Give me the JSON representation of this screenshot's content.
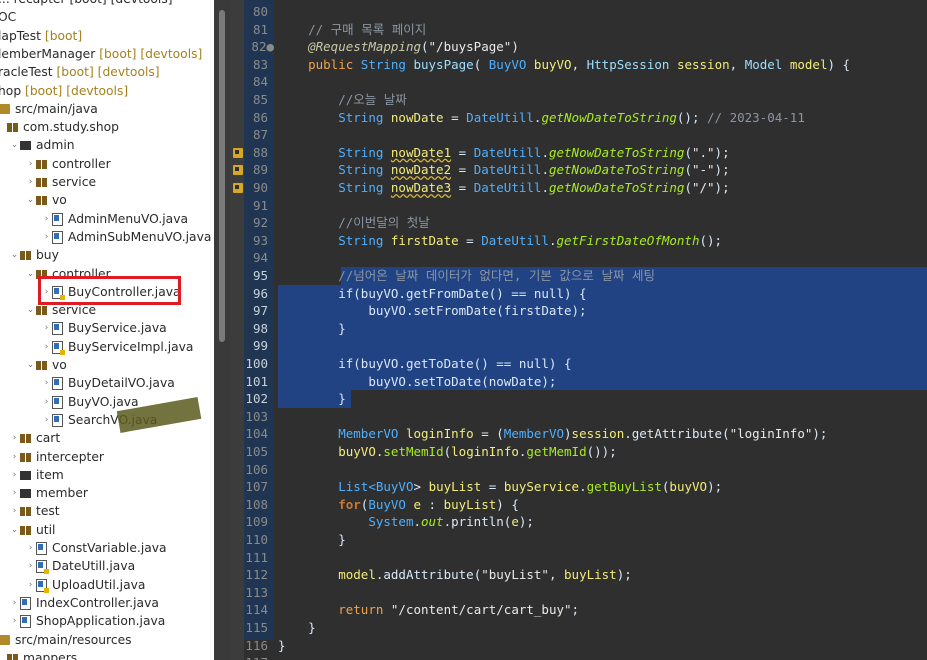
{
  "explorer": {
    "rows": [
      {
        "indent": 0,
        "tw": "",
        "icon": "blank",
        "text": "... recapter [boot] [devtools]"
      },
      {
        "indent": 0,
        "tw": "",
        "icon": "blank",
        "text": "OC"
      },
      {
        "indent": 0,
        "tw": "",
        "icon": "blank",
        "text": "lapTest",
        "suffix": " [boot]"
      },
      {
        "indent": 0,
        "tw": "",
        "icon": "blank",
        "text": "lemberManager",
        "suffix": " [boot] [devtools]"
      },
      {
        "indent": 0,
        "tw": "",
        "icon": "blank",
        "text": "racleTest",
        "suffix": " [boot] [devtools]"
      },
      {
        "indent": 0,
        "tw": "",
        "icon": "blank",
        "text": "hop",
        "suffix": " [boot] [devtools]"
      },
      {
        "indent": 0,
        "tw": "",
        "icon": "src",
        "text": "src/main/java"
      },
      {
        "indent": 1,
        "tw": "",
        "icon": "pkg",
        "text": "com.study.shop"
      },
      {
        "indent": 2,
        "tw": "⌄",
        "icon": "pkgd",
        "text": "admin"
      },
      {
        "indent": 3,
        "tw": "›",
        "icon": "pkg",
        "text": "controller"
      },
      {
        "indent": 3,
        "tw": "›",
        "icon": "pkg",
        "text": "service"
      },
      {
        "indent": 3,
        "tw": "⌄",
        "icon": "pkg",
        "text": "vo"
      },
      {
        "indent": 4,
        "tw": "›",
        "icon": "java",
        "text": "AdminMenuVO.java"
      },
      {
        "indent": 4,
        "tw": "›",
        "icon": "java",
        "text": "AdminSubMenuVO.java"
      },
      {
        "indent": 2,
        "tw": "⌄",
        "icon": "pkg",
        "text": "buy"
      },
      {
        "indent": 3,
        "tw": "⌄",
        "icon": "pkg",
        "text": "controller"
      },
      {
        "indent": 4,
        "tw": "›",
        "icon": "javaw",
        "text": "BuyController.java"
      },
      {
        "indent": 3,
        "tw": "⌄",
        "icon": "pkg",
        "text": "service"
      },
      {
        "indent": 4,
        "tw": "›",
        "icon": "java",
        "text": "BuyService.java"
      },
      {
        "indent": 4,
        "tw": "›",
        "icon": "javaw",
        "text": "BuyServiceImpl.java"
      },
      {
        "indent": 3,
        "tw": "⌄",
        "icon": "pkg",
        "text": "vo"
      },
      {
        "indent": 4,
        "tw": "›",
        "icon": "java",
        "text": "BuyDetailVO.java"
      },
      {
        "indent": 4,
        "tw": "›",
        "icon": "java",
        "text": "BuyVO.java"
      },
      {
        "indent": 4,
        "tw": "›",
        "icon": "java",
        "text": "SearchVO.java"
      },
      {
        "indent": 2,
        "tw": "›",
        "icon": "pkg",
        "text": "cart"
      },
      {
        "indent": 2,
        "tw": "›",
        "icon": "pkg",
        "text": "intercepter"
      },
      {
        "indent": 2,
        "tw": "›",
        "icon": "pkgd",
        "text": "item"
      },
      {
        "indent": 2,
        "tw": "›",
        "icon": "pkgd",
        "text": "member"
      },
      {
        "indent": 2,
        "tw": "›",
        "icon": "pkg",
        "text": "test"
      },
      {
        "indent": 2,
        "tw": "⌄",
        "icon": "pkg",
        "text": "util"
      },
      {
        "indent": 3,
        "tw": "›",
        "icon": "java",
        "text": "ConstVariable.java"
      },
      {
        "indent": 3,
        "tw": "›",
        "icon": "javaw",
        "text": "DateUtill.java"
      },
      {
        "indent": 3,
        "tw": "›",
        "icon": "javaw",
        "text": "UploadUtil.java"
      },
      {
        "indent": 2,
        "tw": "›",
        "icon": "java",
        "text": "IndexController.java"
      },
      {
        "indent": 2,
        "tw": "›",
        "icon": "java",
        "text": "ShopApplication.java"
      },
      {
        "indent": 0,
        "tw": "",
        "icon": "src",
        "text": "src/main/resources"
      },
      {
        "indent": 1,
        "tw": "",
        "icon": "pkg",
        "text": "mappers"
      }
    ]
  },
  "editor": {
    "lines": [
      {
        "n": "80",
        "t": []
      },
      {
        "n": "81",
        "t": [
          [
            "    ",
            "txt"
          ],
          [
            "// 구매 목록 페이지",
            "com"
          ]
        ]
      },
      {
        "n": "82●",
        "t": [
          [
            "    ",
            "txt"
          ],
          [
            "@RequestMapping",
            "ann"
          ],
          [
            "(",
            "txt"
          ],
          [
            "\"/buysPage\"",
            "str"
          ],
          [
            ")",
            "txt"
          ]
        ]
      },
      {
        "n": "83",
        "t": [
          [
            "    ",
            "txt"
          ],
          [
            "public ",
            "kwp"
          ],
          [
            "String ",
            "typ"
          ],
          [
            "buysPage",
            "fld"
          ],
          [
            "( ",
            "txt"
          ],
          [
            "BuyVO ",
            "typ"
          ],
          [
            "buyVO",
            "var"
          ],
          [
            ", ",
            "txt"
          ],
          [
            "HttpSession ",
            "fld"
          ],
          [
            "session",
            "var"
          ],
          [
            ", ",
            "txt"
          ],
          [
            "Model ",
            "fld"
          ],
          [
            "model",
            "var"
          ],
          [
            ") {",
            "txt"
          ]
        ]
      },
      {
        "n": "84",
        "t": []
      },
      {
        "n": "85",
        "t": [
          [
            "        ",
            "txt"
          ],
          [
            "//오늘 날짜",
            "com"
          ]
        ]
      },
      {
        "n": "86",
        "t": [
          [
            "        ",
            "txt"
          ],
          [
            "String ",
            "typ"
          ],
          [
            "nowDate",
            "var"
          ],
          [
            " = ",
            "txt"
          ],
          [
            "DateUtill",
            "typ"
          ],
          [
            ".",
            "txt"
          ],
          [
            "getNowDateToString",
            "mth"
          ],
          [
            "(); ",
            "txt"
          ],
          [
            "// 2023-04-11",
            "com"
          ]
        ]
      },
      {
        "n": "87",
        "t": []
      },
      {
        "n": "88",
        "t": [
          [
            "        ",
            "txt"
          ],
          [
            "String ",
            "typ"
          ],
          [
            "nowDate1",
            "varw"
          ],
          [
            " = ",
            "txt"
          ],
          [
            "DateUtill",
            "typ"
          ],
          [
            ".",
            "txt"
          ],
          [
            "getNowDateToString",
            "mth"
          ],
          [
            "(",
            "txt"
          ],
          [
            "\".\"",
            "str"
          ],
          [
            ");",
            "txt"
          ]
        ]
      },
      {
        "n": "89",
        "t": [
          [
            "        ",
            "txt"
          ],
          [
            "String ",
            "typ"
          ],
          [
            "nowDate2",
            "varw"
          ],
          [
            " = ",
            "txt"
          ],
          [
            "DateUtill",
            "typ"
          ],
          [
            ".",
            "txt"
          ],
          [
            "getNowDateToString",
            "mth"
          ],
          [
            "(",
            "txt"
          ],
          [
            "\"-\"",
            "str"
          ],
          [
            ");",
            "txt"
          ]
        ]
      },
      {
        "n": "90",
        "t": [
          [
            "        ",
            "txt"
          ],
          [
            "String ",
            "typ"
          ],
          [
            "nowDate3",
            "varw"
          ],
          [
            " = ",
            "txt"
          ],
          [
            "DateUtill",
            "typ"
          ],
          [
            ".",
            "txt"
          ],
          [
            "getNowDateToString",
            "mth"
          ],
          [
            "(",
            "txt"
          ],
          [
            "\"/\"",
            "str"
          ],
          [
            ");",
            "txt"
          ]
        ]
      },
      {
        "n": "91",
        "t": []
      },
      {
        "n": "92",
        "t": [
          [
            "        ",
            "txt"
          ],
          [
            "//이번달의 첫날",
            "com"
          ]
        ]
      },
      {
        "n": "93",
        "t": [
          [
            "        ",
            "txt"
          ],
          [
            "String ",
            "typ"
          ],
          [
            "firstDate",
            "var"
          ],
          [
            " = ",
            "txt"
          ],
          [
            "DateUtill",
            "typ"
          ],
          [
            ".",
            "txt"
          ],
          [
            "getFirstDateOfMonth",
            "mth"
          ],
          [
            "();",
            "txt"
          ]
        ]
      },
      {
        "n": "94",
        "t": []
      },
      {
        "n": "95",
        "t": [
          [
            "        ",
            "txt"
          ],
          [
            "//넘어온 날짜 데이터가 없다면, 기본 값으로 날짜 세팅",
            "com"
          ]
        ]
      },
      {
        "n": "96",
        "t": [
          [
            "        ",
            "txt"
          ],
          [
            "if(buyVO.getFromDate() == null) {",
            "txt"
          ]
        ]
      },
      {
        "n": "97",
        "t": [
          [
            "            ",
            "txt"
          ],
          [
            "buyVO.setFromDate(firstDate);",
            "txt"
          ]
        ]
      },
      {
        "n": "98",
        "t": [
          [
            "        ",
            "txt"
          ],
          [
            "}",
            "txt"
          ]
        ]
      },
      {
        "n": "99",
        "t": []
      },
      {
        "n": "100",
        "t": [
          [
            "        ",
            "txt"
          ],
          [
            "if(buyVO.getToDate() == null) {",
            "txt"
          ]
        ]
      },
      {
        "n": "101",
        "t": [
          [
            "            ",
            "txt"
          ],
          [
            "buyVO.setToDate(nowDate);",
            "txt"
          ]
        ]
      },
      {
        "n": "102",
        "t": [
          [
            "        ",
            "txt"
          ],
          [
            "}",
            "txt"
          ]
        ]
      },
      {
        "n": "103",
        "t": []
      },
      {
        "n": "104",
        "t": [
          [
            "        ",
            "txt"
          ],
          [
            "MemberVO ",
            "typ"
          ],
          [
            "loginInfo",
            "var"
          ],
          [
            " = (",
            "txt"
          ],
          [
            "MemberVO",
            "typ"
          ],
          [
            ")",
            "txt"
          ],
          [
            "session",
            "var"
          ],
          [
            ".getAttribute(",
            "txt"
          ],
          [
            "\"loginInfo\"",
            "str"
          ],
          [
            ");",
            "txt"
          ]
        ]
      },
      {
        "n": "105",
        "t": [
          [
            "        ",
            "txt"
          ],
          [
            "buyVO",
            "var"
          ],
          [
            ".",
            "txt"
          ],
          [
            "setMemId",
            "mthn"
          ],
          [
            "(",
            "txt"
          ],
          [
            "loginInfo",
            "var"
          ],
          [
            ".",
            "txt"
          ],
          [
            "getMemId",
            "mthn"
          ],
          [
            "());",
            "txt"
          ]
        ]
      },
      {
        "n": "106",
        "t": []
      },
      {
        "n": "107",
        "t": [
          [
            "        ",
            "txt"
          ],
          [
            "List<",
            "typ"
          ],
          [
            "BuyVO",
            "typ"
          ],
          [
            "> ",
            "txt"
          ],
          [
            "buyList",
            "var"
          ],
          [
            " = ",
            "txt"
          ],
          [
            "buyService",
            "var"
          ],
          [
            ".",
            "txt"
          ],
          [
            "getBuyList",
            "mthn"
          ],
          [
            "(",
            "txt"
          ],
          [
            "buyVO",
            "var"
          ],
          [
            ");",
            "txt"
          ]
        ]
      },
      {
        "n": "108",
        "t": [
          [
            "        ",
            "txt"
          ],
          [
            "for",
            "kw"
          ],
          [
            "(",
            "txt"
          ],
          [
            "BuyVO ",
            "typ"
          ],
          [
            "e",
            "var"
          ],
          [
            " : ",
            "txt"
          ],
          [
            "buyList",
            "var"
          ],
          [
            ") {",
            "txt"
          ]
        ]
      },
      {
        "n": "109",
        "t": [
          [
            "            ",
            "txt"
          ],
          [
            "System",
            "typ"
          ],
          [
            ".",
            "txt"
          ],
          [
            "out",
            "mth"
          ],
          [
            ".println(",
            "txt"
          ],
          [
            "e",
            "var"
          ],
          [
            ");",
            "txt"
          ]
        ]
      },
      {
        "n": "110",
        "t": [
          [
            "        ",
            "txt"
          ],
          [
            "}",
            "txt"
          ]
        ]
      },
      {
        "n": "111",
        "t": []
      },
      {
        "n": "112",
        "t": [
          [
            "        ",
            "txt"
          ],
          [
            "model",
            "var"
          ],
          [
            ".addAttribute(",
            "txt"
          ],
          [
            "\"buyList\"",
            "str"
          ],
          [
            ", ",
            "txt"
          ],
          [
            "buyList",
            "var"
          ],
          [
            ");",
            "txt"
          ]
        ]
      },
      {
        "n": "113",
        "t": []
      },
      {
        "n": "114",
        "t": [
          [
            "        ",
            "txt"
          ],
          [
            "return ",
            "kwp"
          ],
          [
            "\"/content/cart/cart_buy\"",
            "str"
          ],
          [
            ";",
            "txt"
          ]
        ]
      },
      {
        "n": "115",
        "t": [
          [
            "    ",
            "txt"
          ],
          [
            "}",
            "txt"
          ]
        ]
      },
      {
        "n": "116",
        "t": [
          [
            "}",
            "txt"
          ]
        ]
      },
      {
        "n": "117",
        "t": []
      }
    ]
  },
  "colors": {
    "selection": "#214283",
    "accent_box": "#e01b24",
    "warning": "#d8a824"
  },
  "icons": [
    "package-icon",
    "source-folder-icon",
    "java-file-icon",
    "warning-icon",
    "breakpoint-icon",
    "chevron-right-icon",
    "chevron-down-icon"
  ]
}
